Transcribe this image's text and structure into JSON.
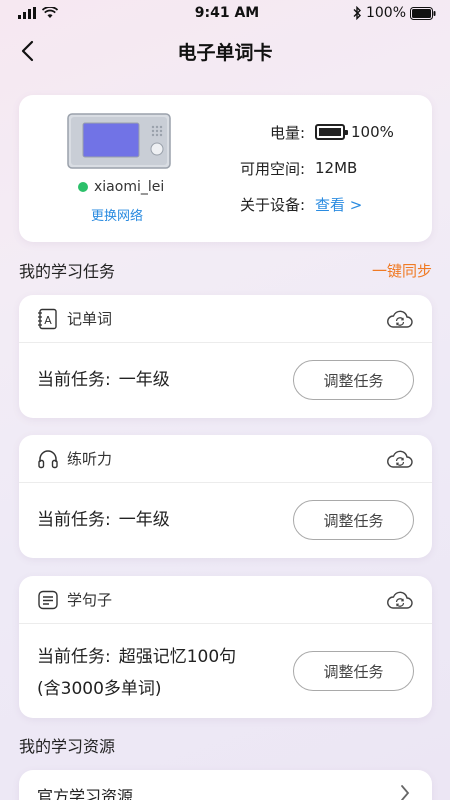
{
  "status_bar": {
    "time": "9:41 AM",
    "battery": "100%"
  },
  "nav": {
    "title": "电子单词卡"
  },
  "device": {
    "name": "xiaomi_lei",
    "switch_network": "更换网络",
    "battery_label": "电量:",
    "battery_value": "100%",
    "battery_level": 1.0,
    "storage_label": "可用空间:",
    "storage_value": "12MB",
    "about_label": "关于设备:",
    "about_link": "查看 >"
  },
  "tasks_section": {
    "title": "我的学习任务",
    "sync": "一键同步",
    "items": [
      {
        "name": "记单词",
        "icon": "word-card-icon",
        "label": "当前任务:",
        "value": "一年级",
        "button": "调整任务"
      },
      {
        "name": "练听力",
        "icon": "headphones-icon",
        "label": "当前任务:",
        "value": "一年级",
        "button": "调整任务"
      },
      {
        "name": "学句子",
        "icon": "sentence-icon",
        "label": "当前任务:",
        "value": "超强记忆100句",
        "value2": "(含3000多单词)",
        "button": "调整任务"
      }
    ]
  },
  "resources_section": {
    "title": "我的学习资源",
    "items": [
      {
        "label": "官方学习资源"
      }
    ]
  },
  "colors": {
    "accent_blue": "#2a8be0",
    "accent_orange": "#f07a24",
    "online_green": "#2cc06a"
  }
}
